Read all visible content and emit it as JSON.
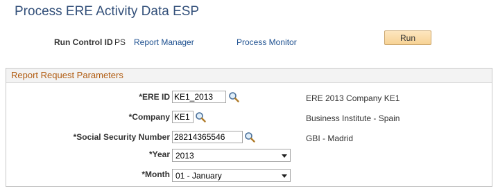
{
  "page": {
    "title": "Process ERE Activity Data ESP"
  },
  "run_control": {
    "label": "Run Control ID",
    "value": "PS",
    "report_manager_link": "Report Manager",
    "process_monitor_link": "Process Monitor",
    "run_button": "Run"
  },
  "group": {
    "title": "Report Request Parameters",
    "fields": {
      "ere_id": {
        "label": "*ERE ID",
        "value": "KE1_2013",
        "description": "ERE 2013 Company KE1"
      },
      "company": {
        "label": "*Company",
        "value": "KE1",
        "description": "Business Institute - Spain"
      },
      "ssn": {
        "label": "*Social Security Number",
        "value": "28214365546",
        "description": "GBI - Madrid"
      },
      "year": {
        "label": "*Year",
        "value": "2013"
      },
      "month": {
        "label": "*Month",
        "value": "01 - January"
      }
    }
  },
  "icons": {
    "lookup": "magnifier-icon",
    "dropdown": "chevron-down-icon"
  },
  "colors": {
    "title": "#33507a",
    "group_title": "#b05b10",
    "link": "#1c4f8f",
    "button": "#f7d395"
  }
}
